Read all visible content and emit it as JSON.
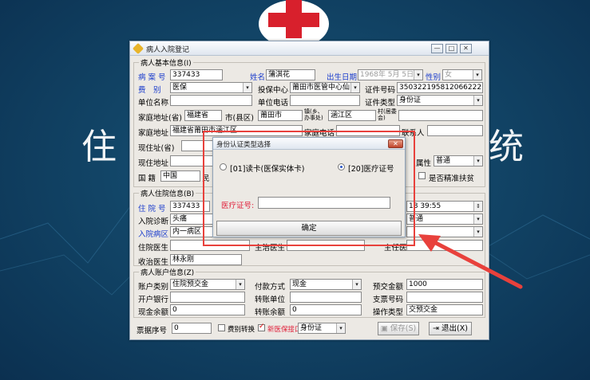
{
  "background": {
    "left_char": "住",
    "right_char": "统"
  },
  "window": {
    "title": "病人入院登记"
  },
  "basic": {
    "group_title": "病人基本信息(I)",
    "case_no_label": "病 案 号",
    "case_no": "337433",
    "name_label": "姓名",
    "name": "蒲淇花",
    "birth_label": "出生日期",
    "birth": "1968年 5月 5日",
    "sex_label": "性别",
    "sex": "女",
    "fee_label": "费　别",
    "fee": "医保",
    "insure_label": "投保中心",
    "insure": "莆田市医管中心仙",
    "cert_no_label": "证件号码",
    "cert_no": "350322195812066222",
    "employer_label": "单位名称",
    "employer": "",
    "unit_phone_label": "单位电话",
    "unit_phone": "",
    "cert_type_label": "证件类型",
    "cert_type": "身份证",
    "home_addr_label": "家庭地址(省)",
    "province": "福建省",
    "city_label": "市(县区)",
    "city": "莆田市",
    "town_label": "镇(乡、办事处)",
    "town": "涵江区",
    "village_label": "村(居委会)",
    "village": "",
    "home_label": "家庭地址",
    "home": "福建省莆田市涵江区",
    "home_phone_label": "家庭电话",
    "home_phone": "",
    "contact_label": "联系人",
    "contact": "",
    "cur_addr_prov_label": "现住址(省)",
    "cur_addr_label": "现住地址",
    "attr_label": "属性",
    "attr": "普通",
    "nation_label": "国 籍",
    "nation": "中国",
    "ethnic_label": "民",
    "poverty_label": "是否精准扶贫"
  },
  "hosp": {
    "group_title": "病人住院信息(B)",
    "hosp_no_label": "住 院 号",
    "hosp_no": "337433",
    "time": "18 39:55",
    "diag_label": "入院诊断",
    "diag": "头痛",
    "level": "普通",
    "ward_label": "入院病区",
    "ward": "内一病区",
    "doctor_label": "住院医生",
    "doctor": "",
    "attending_label": "主治医生",
    "chief_label": "主任医生",
    "admit_doctor_label": "收治医生",
    "admit_doctor": "林永刚"
  },
  "account": {
    "group_title": "病人账户信息(Z)",
    "type_label": "账户类别",
    "type": "住院预交金",
    "pay_label": "付款方式",
    "pay": "现金",
    "deposit_label": "预交金额",
    "deposit": "1000",
    "bank_label": "开户银行",
    "bank": "",
    "transfer_unit_label": "转账单位",
    "transfer_unit": "",
    "check_label": "支票号码",
    "check": "",
    "cash_label": "现金余额",
    "cash": "0",
    "transfer_bal_label": "转账余额",
    "transfer_bal": "0",
    "op_type_label": "操作类型",
    "op_type": "交预交金"
  },
  "footer": {
    "ticket_label": "票据序号",
    "ticket": "0",
    "fee_transfer_label": "费别转换",
    "new_interface_label": "新医保接口",
    "cert_select": "身份证",
    "save_label": "保存(S)",
    "exit_label": "退出(X)"
  },
  "dialog": {
    "title": "身份认证类型选择",
    "opt1": "[01]读卡(医保实体卡)",
    "opt2": "[20]医疗证号",
    "cert_label": "医疗证号:",
    "cert_value": "",
    "ok_label": "确定"
  },
  "colors": {
    "label_blue": "#1a3ccc",
    "label_red": "#e0203a",
    "highlight": "#e8413c"
  }
}
